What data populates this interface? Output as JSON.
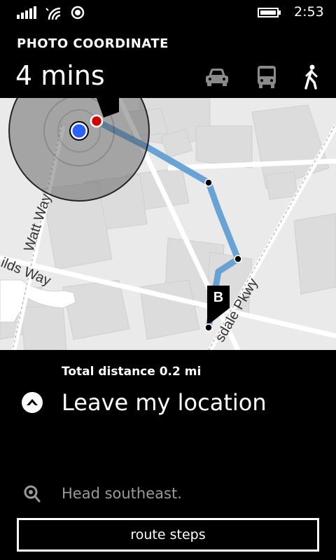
{
  "status_bar": {
    "time": "2:53",
    "icons": [
      "signal-strength-icon",
      "wifi-icon",
      "location-icon",
      "battery-icon"
    ]
  },
  "header": {
    "title": "PHOTO COORDINATE",
    "duration": "4 mins",
    "modes": [
      {
        "name": "car",
        "icon": "car-icon"
      },
      {
        "name": "bus",
        "icon": "bus-icon"
      },
      {
        "name": "walk",
        "icon": "walk-icon"
      }
    ]
  },
  "map": {
    "street_labels": [
      "Watt Way",
      "ilds Way",
      "sdale Pkwy"
    ],
    "destination_marker": "B",
    "colors": {
      "route": "#5b9bd1",
      "current_location": "#2962ff",
      "start_point": "#d40000"
    }
  },
  "directions": {
    "total_distance": "Total distance 0.2 mi",
    "current_step": "Leave my location",
    "next_step": "Head southeast."
  },
  "buttons": {
    "route_steps": "route steps"
  }
}
